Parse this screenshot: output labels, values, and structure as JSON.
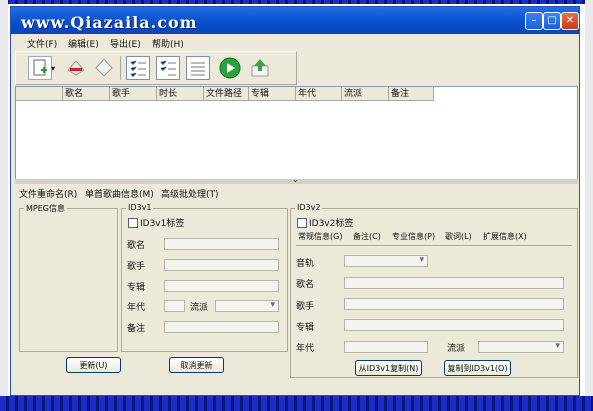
{
  "window": {
    "title": "www.Qiazaila.com"
  },
  "menu": [
    "文件(F)",
    "编辑(E)",
    "导出(E)",
    "帮助(H)"
  ],
  "toolbar_icons": [
    "add-file-icon",
    "dropdown-arrow-icon",
    "remove-icon",
    "clear-icon",
    "checklist-icon",
    "checklist-alt-icon",
    "list-icon",
    "play-icon",
    "export-icon"
  ],
  "list": {
    "columns": [
      "",
      "歌名",
      "歌手",
      "时长",
      "文件路径",
      "专辑",
      "年代",
      "流派",
      "备注"
    ]
  },
  "tabs": [
    "文件重命名(R)",
    "单首歌曲信息(M)",
    "高级批处理(T)"
  ],
  "mpeg": {
    "title": "MPEG信息"
  },
  "id3v1": {
    "title": "ID3v1",
    "tag_label": "ID3v1标签",
    "song_name": "歌名",
    "artist": "歌手",
    "album": "专辑",
    "year": "年代",
    "genre": "流派",
    "comment": "备注"
  },
  "id3v2": {
    "title": "ID3v2",
    "tag_label": "ID3v2标签",
    "subtabs": [
      "常规信息(G)",
      "备注(C)",
      "专业信息(P)",
      "歌词(L)",
      "扩展信息(X)"
    ],
    "track": "音轨",
    "song_name": "歌名",
    "artist": "歌手",
    "album": "专辑",
    "year": "年代",
    "genre": "流派"
  },
  "buttons": {
    "update": "更新(U)",
    "cancel_update": "取消更新",
    "copy_from_v1": "从ID3v1复制(N)",
    "copy_to_v1": "复制到ID3v1(O)"
  }
}
